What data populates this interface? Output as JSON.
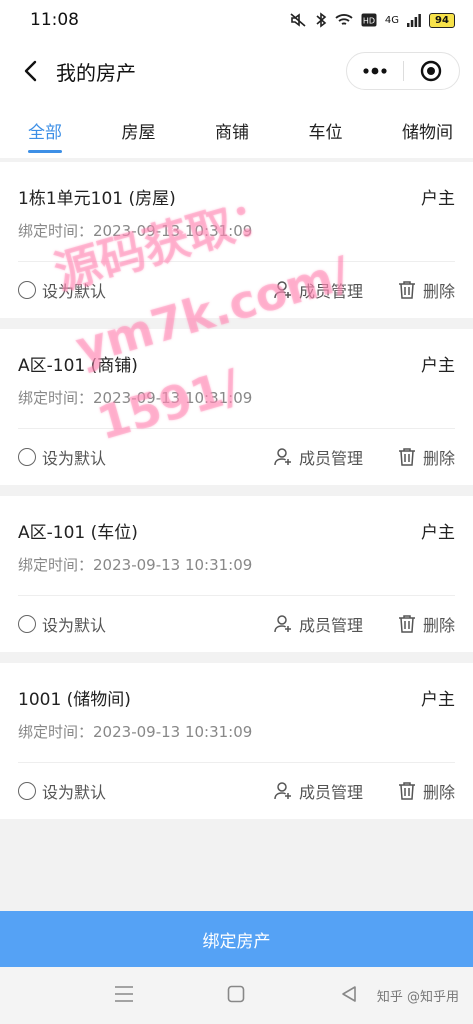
{
  "status_bar": {
    "time": "11:08",
    "network": "4G",
    "battery": "94"
  },
  "nav": {
    "title": "我的房产"
  },
  "tabs": [
    {
      "label": "全部",
      "active": true
    },
    {
      "label": "房屋",
      "active": false
    },
    {
      "label": "商铺",
      "active": false
    },
    {
      "label": "车位",
      "active": false
    },
    {
      "label": "储物间",
      "active": false
    }
  ],
  "labels": {
    "bind_time_prefix": "绑定时间：",
    "set_default": "设为默认",
    "member_manage": "成员管理",
    "delete": "删除"
  },
  "properties": [
    {
      "name": "1栋1单元101 (房屋)",
      "role": "户主",
      "bind_time": "2023-09-13 10:31:09"
    },
    {
      "name": "A区-101 (商铺)",
      "role": "户主",
      "bind_time": "2023-09-13 10:31:09"
    },
    {
      "name": "A区-101 (车位)",
      "role": "户主",
      "bind_time": "2023-09-13 10:31:09"
    },
    {
      "name": "1001 (储物间)",
      "role": "户主",
      "bind_time": "2023-09-13 10:31:09"
    }
  ],
  "bottom_button": {
    "label": "绑定房产"
  },
  "watermark": {
    "line1": "源码获取：",
    "line2": "ym7k.com/",
    "line3": "1591/"
  },
  "system_nav": {
    "watermark": "知乎 @知乎用"
  },
  "colors": {
    "accent": "#3d8fe6",
    "button": "#55a2f5"
  }
}
